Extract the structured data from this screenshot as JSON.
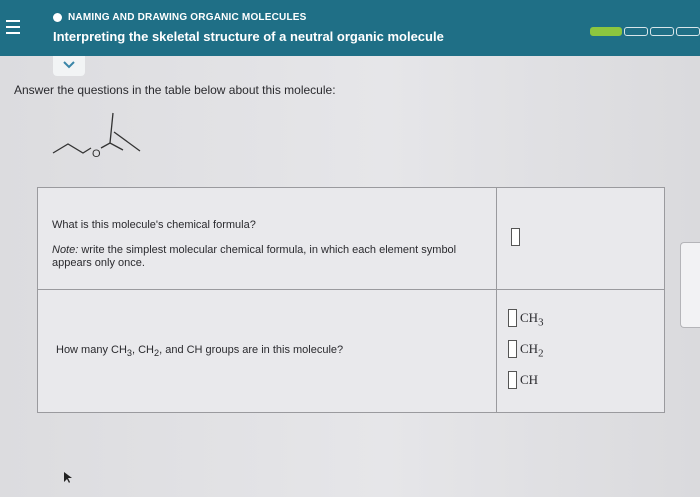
{
  "header": {
    "topic": "NAMING AND DRAWING ORGANIC MOLECULES",
    "title": "Interpreting the skeletal structure of a neutral organic molecule",
    "progress": {
      "completed_segments": 1,
      "total_segments": 4
    }
  },
  "instruction": "Answer the questions in the table below about this molecule:",
  "molecule": {
    "atom_label": "O"
  },
  "table": {
    "formula_question": "What is this molecule's chemical formula?",
    "note_prefix": "Note:",
    "note_text": "write the simplest molecular chemical formula, in which each element symbol appears only once.",
    "groups_question": {
      "prefix": "How many CH",
      "sub1": "3",
      "mid1": ", CH",
      "sub2": "2",
      "suffix": ", and CH groups are in this molecule?"
    },
    "formula_value": "",
    "groups": [
      {
        "label": "CH",
        "sub": "3",
        "value": ""
      },
      {
        "label": "CH",
        "sub": "2",
        "value": ""
      },
      {
        "label": "CH",
        "sub": "",
        "value": ""
      }
    ]
  },
  "colors": {
    "header": "#1f6f86",
    "progress_done": "#8cc63f"
  },
  "icons": [
    "menu-icon",
    "chevron-down-icon",
    "cursor-icon"
  ]
}
